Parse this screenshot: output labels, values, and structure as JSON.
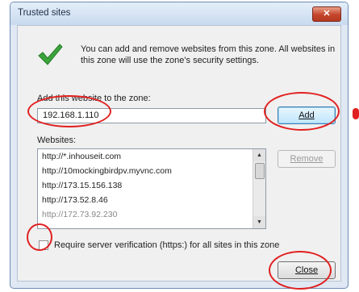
{
  "window": {
    "title": "Trusted sites",
    "close_glyph": "✕"
  },
  "info_text": "You can add and remove websites from this zone. All websites in this zone will use the zone's security settings.",
  "add_label": "Add this website to the zone:",
  "add_input_value": "192.168.1.110",
  "buttons": {
    "add": "Add",
    "remove": "Remove",
    "close": "Close"
  },
  "websites_label": "Websites:",
  "websites": [
    "http://*.inhouseit.com",
    "http://10mockingbirdpv.myvnc.com",
    "http://173.15.156.138",
    "http://173.52.8.46",
    "http://172.73.92.230"
  ],
  "require_https_label": "Require server verification (https:) for all sites in this zone",
  "require_https_checked": false,
  "colors": {
    "annotation": "#e0201f",
    "check_green": "#3aa33a"
  },
  "icons": [
    "check-icon",
    "close-icon",
    "scroll-up-icon",
    "scroll-down-icon"
  ]
}
